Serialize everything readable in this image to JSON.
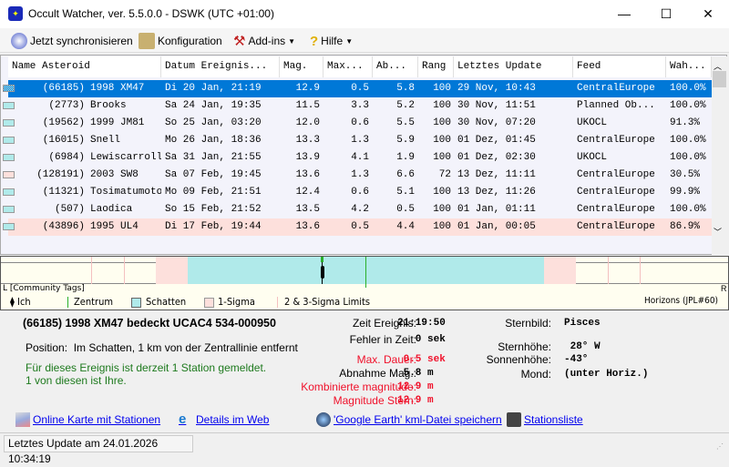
{
  "window": {
    "title": "Occult Watcher, ver. 5.5.0.0 - DSWK (UTC +01:00)"
  },
  "toolbar": {
    "sync": "Jetzt synchronisieren",
    "config": "Konfiguration",
    "addins": "Add-ins",
    "help": "Hilfe"
  },
  "table": {
    "columns": [
      "Name Asteroid",
      "Datum Ereignis...",
      "Mag.",
      "Max...",
      "Ab...",
      "Rang",
      "Letztes Update",
      "Feed",
      "Wah..."
    ],
    "rows": [
      {
        "name": "(66185) 1998 XM47",
        "date": "Di 20 Jan, 21:19",
        "mag": "12.9",
        "max": "0.5",
        "ab": "5.8",
        "rang": "100",
        "update": "29 Nov, 10:43",
        "feed": "CentralEurope",
        "prob": "100.0%",
        "swatch": "#b0eaea",
        "state": "selected"
      },
      {
        "name": "(2773) Brooks",
        "date": "Sa 24 Jan, 19:35",
        "mag": "11.5",
        "max": "3.3",
        "ab": "5.2",
        "rang": "100",
        "update": "30 Nov, 11:51",
        "feed": "Planned Ob...",
        "prob": "100.0%",
        "swatch": "#b0eaea",
        "state": ""
      },
      {
        "name": "(19562) 1999 JM81",
        "date": "So 25 Jan, 03:20",
        "mag": "12.0",
        "max": "0.6",
        "ab": "5.5",
        "rang": "100",
        "update": "30 Nov, 07:20",
        "feed": "UKOCL",
        "prob": "91.3%",
        "swatch": "#b0eaea",
        "state": ""
      },
      {
        "name": "(16015) Snell",
        "date": "Mo 26 Jan, 18:36",
        "mag": "13.3",
        "max": "1.3",
        "ab": "5.9",
        "rang": "100",
        "update": "01 Dez, 01:45",
        "feed": "CentralEurope",
        "prob": "100.0%",
        "swatch": "#b0eaea",
        "state": ""
      },
      {
        "name": "(6984) Lewiscarroll",
        "date": "Sa 31 Jan, 21:55",
        "mag": "13.9",
        "max": "4.1",
        "ab": "1.9",
        "rang": "100",
        "update": "01 Dez, 02:30",
        "feed": "UKOCL",
        "prob": "100.0%",
        "swatch": "#b0eaea",
        "state": ""
      },
      {
        "name": "(128191) 2003 SW8",
        "date": "Sa 07 Feb, 19:45",
        "mag": "13.6",
        "max": "1.3",
        "ab": "6.6",
        "rang": "72",
        "update": "13 Dez, 11:11",
        "feed": "CentralEurope",
        "prob": "30.5%",
        "swatch": "#fde0dc",
        "state": ""
      },
      {
        "name": "(11321) Tosimatumoto",
        "date": "Mo 09 Feb, 21:51",
        "mag": "12.4",
        "max": "0.6",
        "ab": "5.1",
        "rang": "100",
        "update": "13 Dez, 11:26",
        "feed": "CentralEurope",
        "prob": "99.9%",
        "swatch": "#b0eaea",
        "state": ""
      },
      {
        "name": "(507) Laodica",
        "date": "So 15 Feb, 21:52",
        "mag": "13.5",
        "max": "4.2",
        "ab": "0.5",
        "rang": "100",
        "update": "01 Jan, 01:11",
        "feed": "CentralEurope",
        "prob": "100.0%",
        "swatch": "#b0eaea",
        "state": ""
      },
      {
        "name": "(43896) 1995 UL4",
        "date": "Di 17 Feb, 19:44",
        "mag": "13.6",
        "max": "0.5",
        "ab": "4.4",
        "rang": "100",
        "update": "01 Jan, 00:05",
        "feed": "CentralEurope",
        "prob": "86.9%",
        "swatch": "#b0eaea",
        "state": "pink"
      }
    ]
  },
  "timeline": {
    "left": "L",
    "tags": "[Community Tags]",
    "right": "R",
    "legend": {
      "me": "Ich",
      "center": "Zentrum",
      "shadow": "Schatten",
      "sigma1": "1-Sigma",
      "sigma23": "2 & 3-Sigma Limits",
      "source": "Horizons (JPL#60)"
    }
  },
  "detail": {
    "title": "(66185) 1998 XM47 bedeckt UCAC4 534-000950",
    "position_label": "Position:",
    "position": "Im Schatten, 1 km von der Zentrallinie entfernt",
    "stations1": "Für dieses Ereignis ist derzeit 1 Station gemeldet.",
    "stations2": "1 von diesen ist Ihre.",
    "fields": [
      {
        "label": "Zeit Ereignis:",
        "value": "21:19:50",
        "red": false
      },
      {
        "label": "Fehler in Zeit:",
        "value": "   0 sek",
        "red": false
      },
      {
        "label": "Max. Dauer:",
        "value": " 0.5 sek",
        "red": true
      },
      {
        "label": "Abnahme Mag.:",
        "value": " 5.8 m",
        "red": false
      },
      {
        "label": "Kombinierte magnitude:",
        "value": "12.9 m",
        "red": true
      },
      {
        "label": "Magnitude Stern:",
        "value": "12.9 m",
        "red": true
      }
    ],
    "right": [
      {
        "label": "Sternbild:",
        "value": "Pisces"
      },
      {
        "label": "Sternhöhe:",
        "value": " 28° W"
      },
      {
        "label": "Sonnenhöhe:",
        "value": "-43°"
      },
      {
        "label": "Mond:",
        "value": "(unter Horiz.)"
      }
    ],
    "links": {
      "map": "Online Karte mit Stationen",
      "web": "Details im Web",
      "kml": "'Google Earth' kml-Datei speichern",
      "stations": "Stationsliste"
    }
  },
  "status": "Letztes Update am 24.01.2026 10:34:19",
  "colors": {
    "selected": "#0078d7",
    "shadow": "#b0eaea",
    "sigma": "#fde0dc",
    "red": "#f0102a",
    "green": "#1e7a1e"
  }
}
